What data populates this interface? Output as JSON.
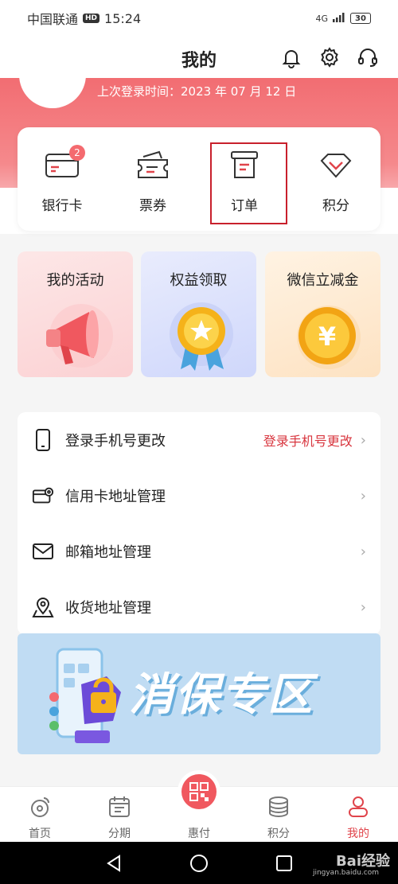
{
  "status_bar": {
    "carrier": "中国联通",
    "hd": "HD",
    "time": "15:24",
    "network": "4G",
    "battery": "30"
  },
  "header": {
    "title": "我的"
  },
  "profile": {
    "last_login": "上次登录时间：2023 年 07 月 12 日"
  },
  "quick_items": [
    {
      "label": "银行卡",
      "badge": "2",
      "icon": "bank-card-icon"
    },
    {
      "label": "票券",
      "icon": "ticket-icon"
    },
    {
      "label": "订单",
      "icon": "order-icon"
    },
    {
      "label": "积分",
      "icon": "points-diamond-icon"
    }
  ],
  "activities": [
    {
      "title": "我的活动",
      "icon": "megaphone-icon"
    },
    {
      "title": "权益领取",
      "icon": "medal-icon"
    },
    {
      "title": "微信立减金",
      "icon": "yen-coin-icon"
    }
  ],
  "menu": [
    {
      "label": "登录手机号更改",
      "value": "登录手机号更改",
      "icon": "phone-icon"
    },
    {
      "label": "信用卡地址管理",
      "icon": "card-location-icon"
    },
    {
      "label": "邮箱地址管理",
      "icon": "mail-icon"
    },
    {
      "label": "收货地址管理",
      "icon": "location-icon"
    }
  ],
  "promo": {
    "text": "消保专区"
  },
  "bottom_nav": [
    {
      "label": "首页",
      "icon": "home-icon"
    },
    {
      "label": "分期",
      "icon": "calendar-icon"
    },
    {
      "label": "惠付",
      "icon": "qr-code-icon"
    },
    {
      "label": "积分",
      "icon": "coins-icon"
    },
    {
      "label": "我的",
      "icon": "user-icon",
      "active": true
    }
  ],
  "watermark": {
    "brand": "Bai经验",
    "site": "jingyan.baidu.com"
  },
  "colors": {
    "accent": "#f0585f",
    "highlight": "#c8202c",
    "link": "#d8353e"
  }
}
